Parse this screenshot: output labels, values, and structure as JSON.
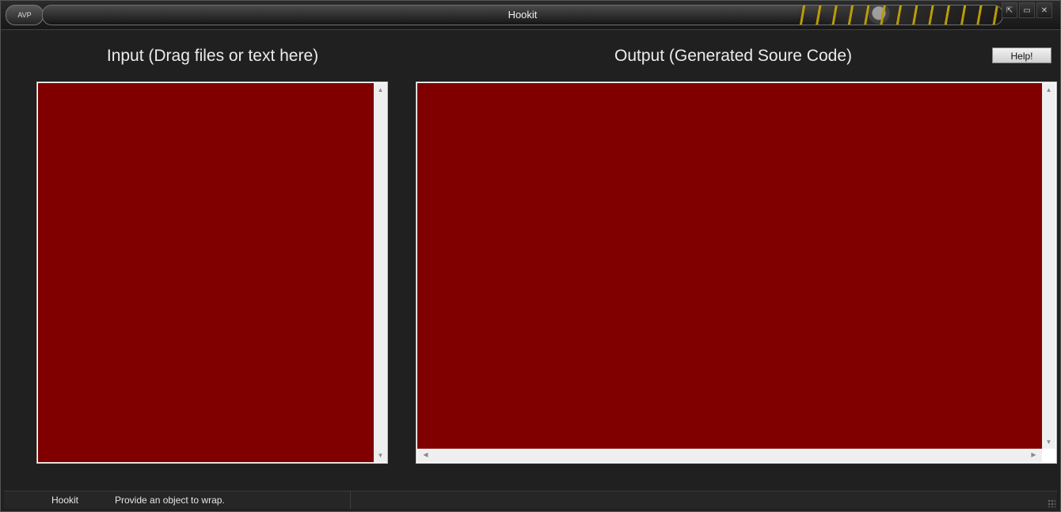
{
  "window": {
    "title": "Hookit",
    "logo_text": "AVP",
    "controls": {
      "minimize": "⇱",
      "restore": "▭",
      "close": "✕"
    }
  },
  "input_panel": {
    "heading": "Input (Drag files or text here)",
    "content": ""
  },
  "output_panel": {
    "heading": "Output (Generated Soure Code)",
    "content": ""
  },
  "toolbar": {
    "help_label": "Help!"
  },
  "statusbar": {
    "app_name": "Hookit",
    "message": "Provide an object to wrap."
  },
  "colors": {
    "panel_background": "#800000",
    "window_background": "#202020"
  }
}
